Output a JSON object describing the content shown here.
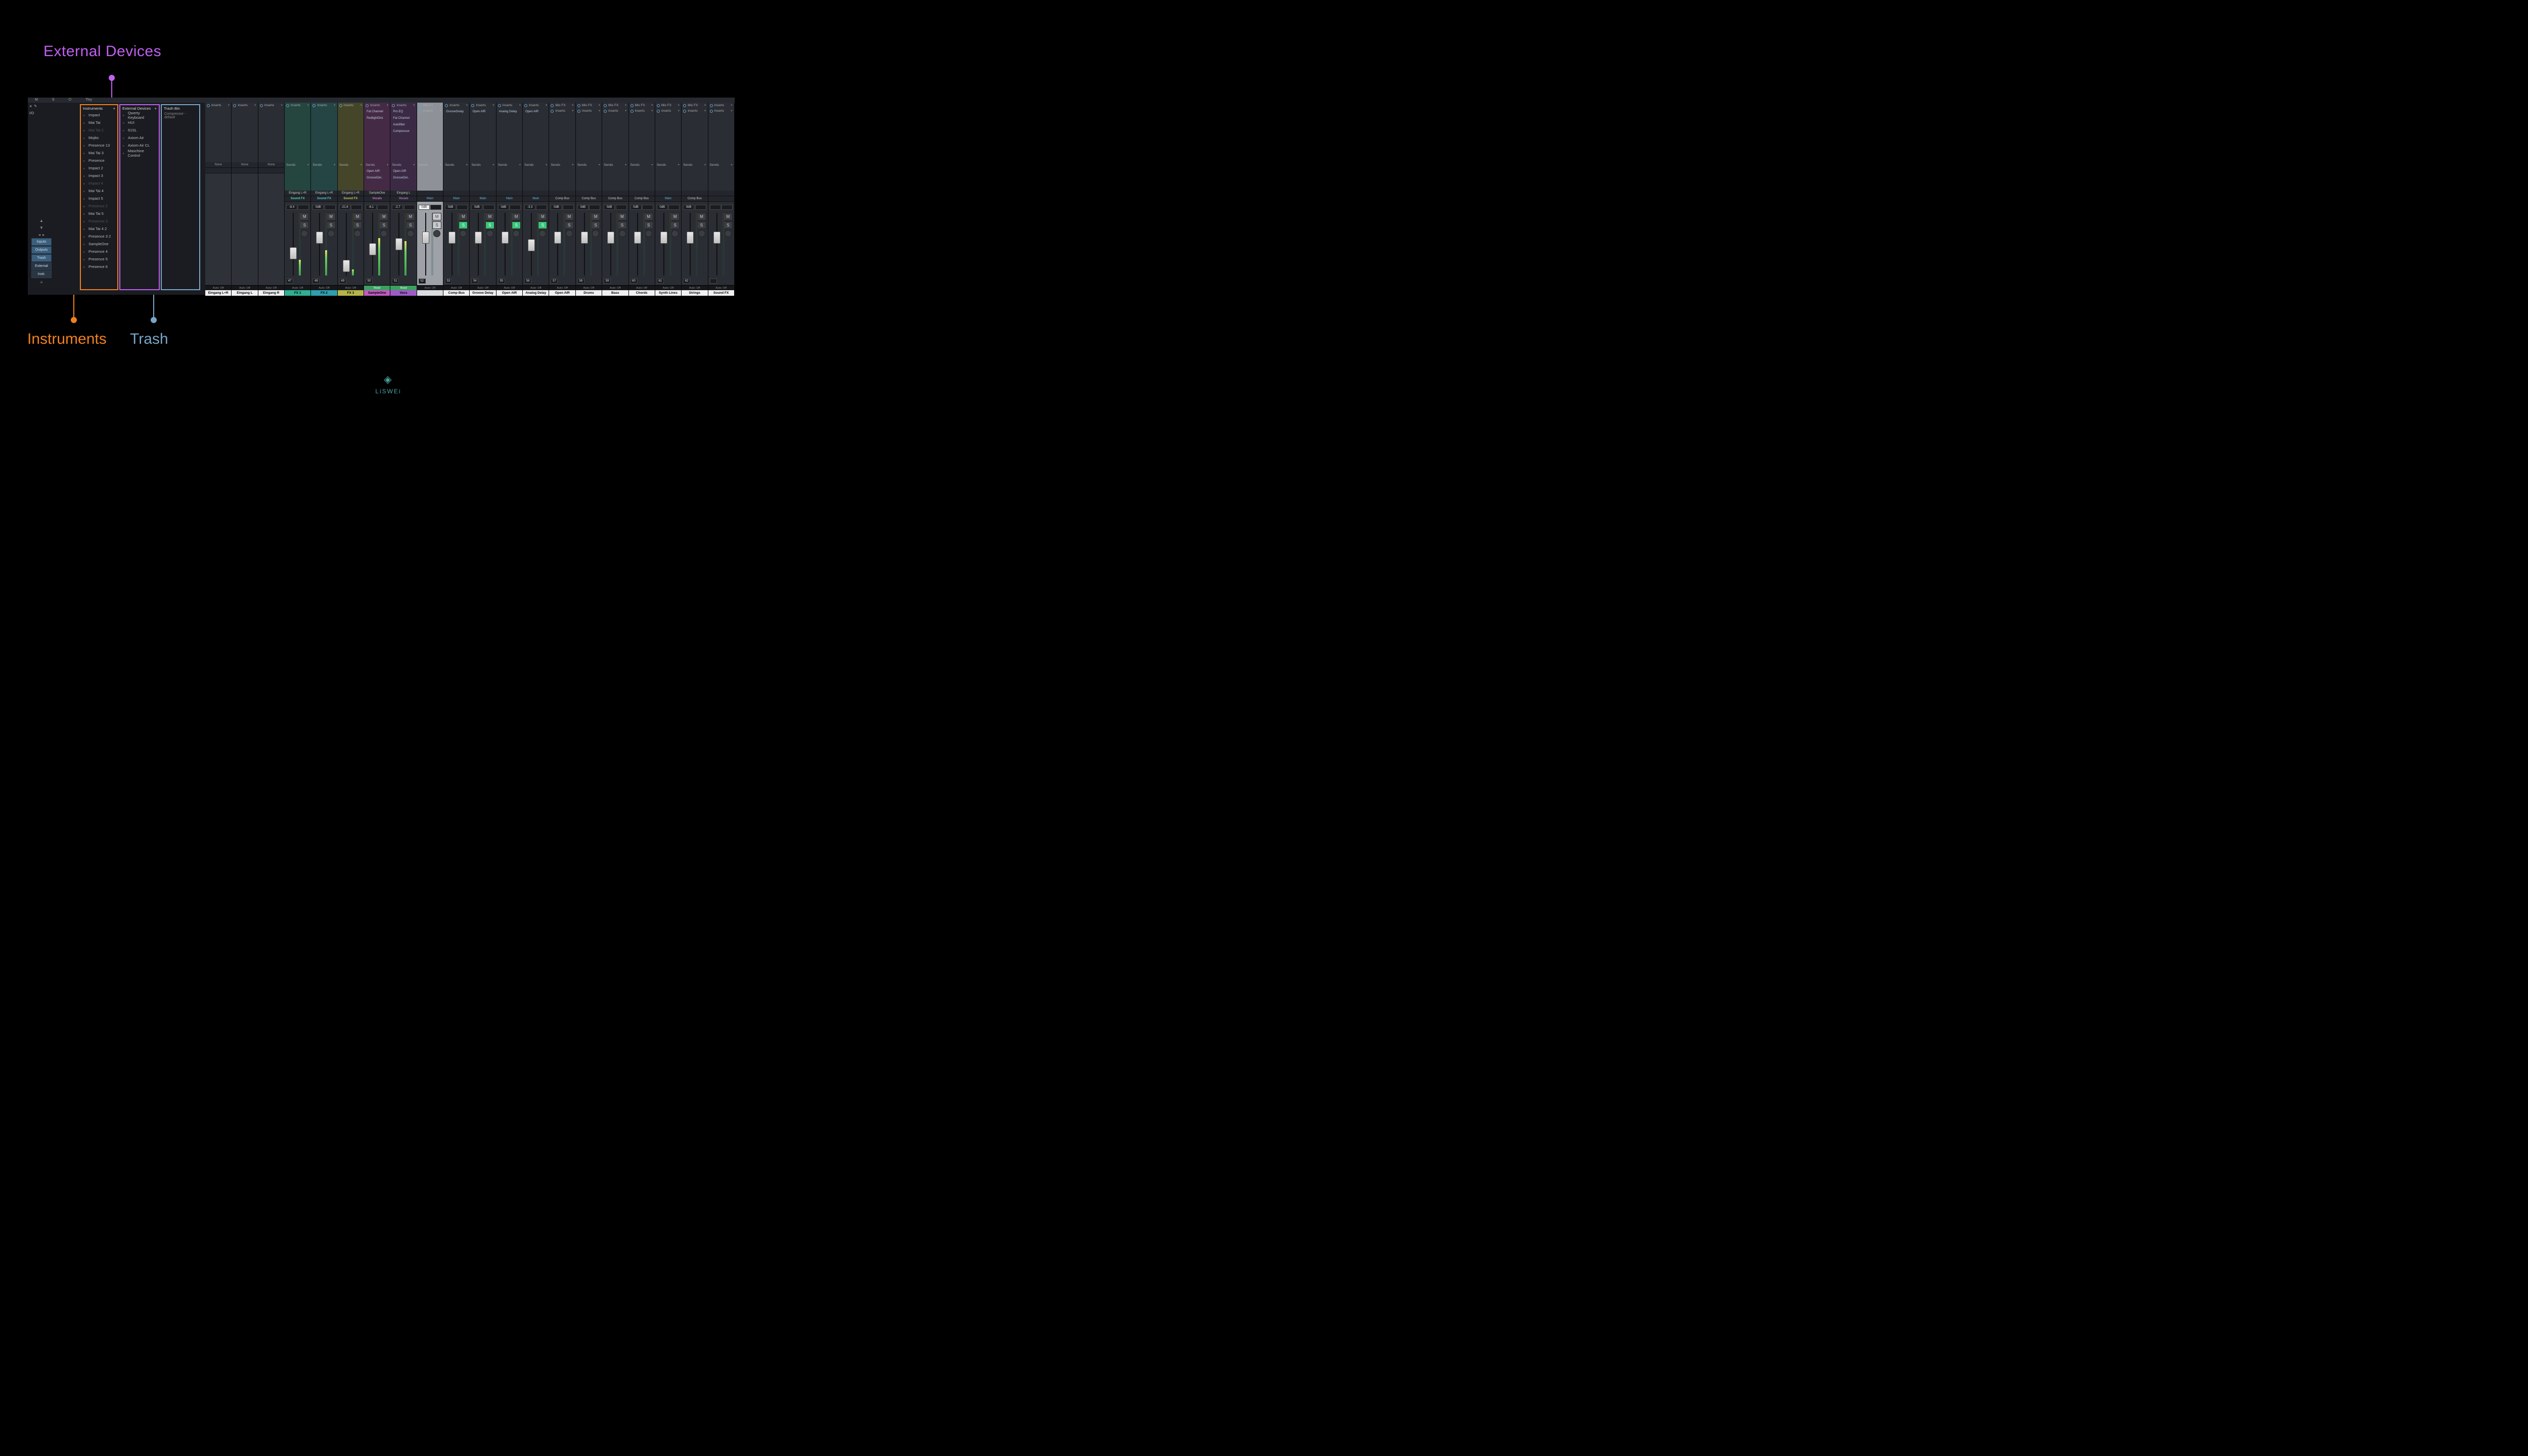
{
  "annotations": {
    "top": "External Devices",
    "bl1": "Instruments",
    "bl2": "Trash"
  },
  "topbar": {
    "m": "M",
    "s": "S",
    "pwr": "⏻",
    "size": "Tiny"
  },
  "leftctl": {
    "close": "×",
    "tool": "✎",
    "io": "I/O",
    "menu_up": "▲",
    "menu_down": "▼",
    "buttons": [
      "Inputs",
      "Outputs",
      "Trash",
      "External",
      "Instr."
    ]
  },
  "columns": {
    "instruments": {
      "header": "Instruments",
      "items": [
        {
          "t": "Impact"
        },
        {
          "t": "Mai Tai"
        },
        {
          "t": "Mai Tai 2",
          "dim": true
        },
        {
          "t": "Mojito"
        },
        {
          "t": "Presence 13"
        },
        {
          "t": "Mai Tai 3"
        },
        {
          "t": "Presence"
        },
        {
          "t": "Impact 2"
        },
        {
          "t": "Impact 3"
        },
        {
          "t": "Impact 4",
          "dim": true
        },
        {
          "t": "Mai Tai 4"
        },
        {
          "t": "Impact 5"
        },
        {
          "t": "Presence 2",
          "dim": true
        },
        {
          "t": "Mai Tai 5"
        },
        {
          "t": "Presence 3",
          "dim": true
        },
        {
          "t": "Mai Tai 4 2"
        },
        {
          "t": "Presence 3 2"
        },
        {
          "t": "SampleOne"
        },
        {
          "t": "Presence 4"
        },
        {
          "t": "Presence 5"
        },
        {
          "t": "Presence 6"
        }
      ]
    },
    "external": {
      "header": "External Devices",
      "items": [
        {
          "t": "Qwerty Keyboard"
        },
        {
          "t": "HUI"
        },
        {
          "t": "61SL"
        },
        {
          "t": "Axiom Air"
        },
        {
          "t": "Axiom Air CL"
        },
        {
          "t": "Maschine Control"
        }
      ]
    },
    "trash": {
      "header": "Trash Bin",
      "sub": "Compressor - default"
    }
  },
  "strings": {
    "inserts": "Inserts",
    "sends": "Sends",
    "mixfx": "Mix FX",
    "none": "None",
    "main": "Main",
    "compbus": "Comp Bus",
    "auto_off": "Auto: Off",
    "auto_read": "Read",
    "pan_c": "<C>",
    "m": "M",
    "s": "S"
  },
  "channels": [
    {
      "num": "",
      "name": "Eingang L+R",
      "bare": true,
      "io1": "None",
      "io2": "",
      "auto": "off",
      "namebg": "#f0f0f0",
      "fg": "#000"
    },
    {
      "num": "",
      "name": "Eingang L",
      "bare": true,
      "io1": "None",
      "io2": "",
      "auto": "off",
      "namebg": "#f0f0f0",
      "fg": "#000"
    },
    {
      "num": "",
      "name": "Eingang R",
      "bare": true,
      "io1": "None",
      "io2": "",
      "auto": "off",
      "namebg": "#f0f0f0",
      "fg": "#000"
    },
    {
      "num": 47,
      "name": "FX 1",
      "tint": "#25453f",
      "io1": "Eingang L+R",
      "io2": "Sound FX",
      "acc": "#50d0b5",
      "db": "-8.4",
      "fpos": 55,
      "meter": 25,
      "auto": "off",
      "namebg": "#2fae92",
      "fg": "#000"
    },
    {
      "num": 48,
      "name": "FX 2",
      "tint": "#254545",
      "io1": "Eingang L+R",
      "io2": "Sound FX",
      "acc": "#50c5d0",
      "db": "0dB",
      "fpos": 30,
      "meter": 40,
      "auto": "off",
      "namebg": "#2f9eae",
      "fg": "#000"
    },
    {
      "num": 49,
      "name": "FX 3",
      "tint": "#45452a",
      "io1": "Eingang L+R",
      "io2": "Sound FX",
      "acc": "#c5c550",
      "db": "-21.6",
      "fpos": 75,
      "meter": 10,
      "auto": "off",
      "namebg": "#b5b54a",
      "fg": "#000"
    },
    {
      "num": 50,
      "name": "SampleOne",
      "tint": "#452a45",
      "io1": "SampleOne",
      "io2": "Vocals",
      "acc": "#d070d0",
      "db": "-6.1",
      "fpos": 48,
      "meter": 60,
      "auto": "read",
      "namebg": "#c05ac0",
      "fg": "#000",
      "ins": [
        "Fat Channel",
        "RedlightDist"
      ],
      "snd": [
        "Open AIR",
        "GrooveDel.."
      ]
    },
    {
      "num": 51,
      "name": "Vocs",
      "tint": "#3c2a45",
      "io1": "Eingang L",
      "io2": "Vocals",
      "acc": "#b070d0",
      "db": "-2.7",
      "fpos": 40,
      "meter": 55,
      "auto": "read",
      "namebg": "#a05ac8",
      "fg": "#000",
      "ins": [
        "Pro EQ",
        "Fat Channel",
        "Autofilter",
        "Compressor"
      ],
      "snd": [
        "Open AIR",
        "GrooveDel.."
      ]
    },
    {
      "num": 52,
      "name": "",
      "light": true,
      "io1": "",
      "io2": "Main",
      "db": "0dB",
      "fpos": 30,
      "auto": "off",
      "namebg": "#dadde0",
      "ins_title": "Mix FX",
      "ins2": "Inserts"
    },
    {
      "num": 53,
      "name": "Comp Bus",
      "io1": "",
      "io2": "Main",
      "db": "0dB",
      "fpos": 30,
      "solo": true,
      "auto": "off",
      "namebg": "#f0f0f0",
      "ins": [
        "GrooveDelay"
      ]
    },
    {
      "num": 54,
      "name": "Groove Delay",
      "io1": "",
      "io2": "Main",
      "db": "0dB",
      "fpos": 30,
      "solo": true,
      "auto": "off",
      "namebg": "#f0f0f0",
      "ins": [
        "Open AIR"
      ]
    },
    {
      "num": 55,
      "name": "Open AIR",
      "io1": "",
      "io2": "Main",
      "db": "0dB",
      "fpos": 30,
      "solo": true,
      "auto": "off",
      "namebg": "#f0f0f0",
      "ins": [
        "Analog Delay"
      ]
    },
    {
      "num": 56,
      "name": "Analog Delay",
      "io1": "",
      "io2": "Main",
      "db": "-3.3",
      "fpos": 42,
      "solo": true,
      "auto": "off",
      "namebg": "#f0f0f0",
      "ins": [
        "Open AIR"
      ]
    },
    {
      "num": 57,
      "name": "Open AIR",
      "io1": "",
      "io2": "Comp Bus",
      "db": "0dB",
      "fpos": 30,
      "auto": "off",
      "namebg": "#f0f0f0",
      "ins_title": "Mix FX",
      "ins2": "Inserts"
    },
    {
      "num": 58,
      "name": "Drums",
      "io1": "",
      "io2": "Comp Bus",
      "db": "0dB",
      "fpos": 30,
      "auto": "off",
      "namebg": "#f0f0f0",
      "ins_title": "Mix FX",
      "ins2": "Inserts"
    },
    {
      "num": 59,
      "name": "Bass",
      "io1": "",
      "io2": "Comp Bus",
      "db": "0dB",
      "fpos": 30,
      "auto": "off",
      "namebg": "#f0f0f0",
      "ins_title": "Mix FX",
      "ins2": "Inserts"
    },
    {
      "num": 60,
      "name": "Chords",
      "io1": "",
      "io2": "Comp Bus",
      "db": "0dB",
      "fpos": 30,
      "auto": "off",
      "namebg": "#f0f0f0",
      "ins_title": "Mix FX",
      "ins2": "Inserts"
    },
    {
      "num": 61,
      "name": "Synth Lines",
      "io1": "",
      "io2": "Main",
      "db": "0dB",
      "fpos": 30,
      "auto": "off",
      "namebg": "#f0f0f0",
      "ins_title": "Mix FX",
      "ins2": "Inserts"
    },
    {
      "num": 62,
      "name": "Strings",
      "io1": "",
      "io2": "Comp Bus",
      "db": "0dB",
      "fpos": 30,
      "auto": "off",
      "namebg": "#f0f0f0",
      "ins_title": "Mix FX",
      "ins2": "Inserts"
    },
    {
      "num": "",
      "name": "Sound FX",
      "io1": "",
      "io2": "",
      "db": "",
      "fpos": 30,
      "auto": "off",
      "namebg": "#f0f0f0",
      "ins2": "Inserts"
    }
  ],
  "watermark": "LiSWEi"
}
